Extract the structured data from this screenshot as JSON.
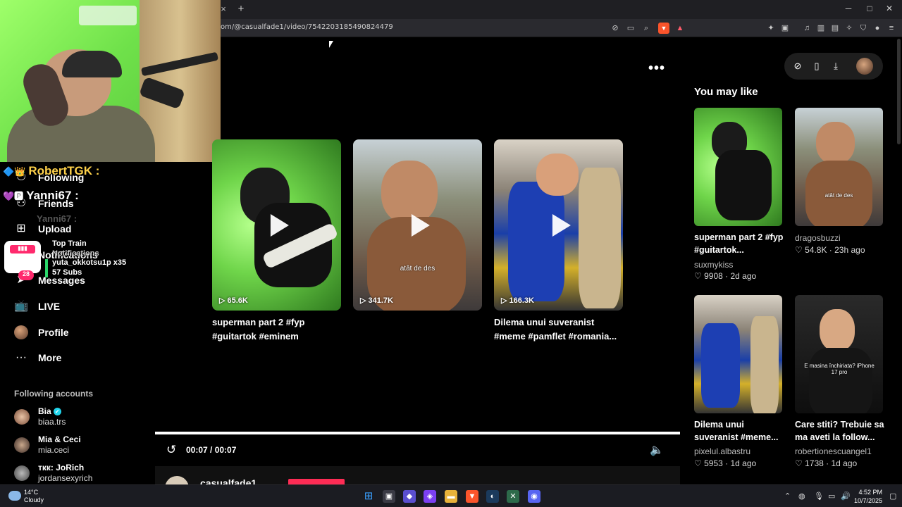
{
  "browser": {
    "url": "om/@casualfade1/video/7542203185490824479",
    "tab_close": "×",
    "new_tab": "+",
    "win_min": "─",
    "win_max": "□",
    "win_close": "✕"
  },
  "chat": {
    "line1_user": "RobertTGK :",
    "line2_user": "Yanni67 :",
    "line3_user": "Yanni67 :",
    "goal_title": "Top Train",
    "goal_line2": "Notifications",
    "goal_user": "yuta_okkotsu1p x35",
    "goal_subs": "57 Subs",
    "goal_badge": "28"
  },
  "nav": {
    "items": [
      {
        "label": "Following"
      },
      {
        "label": "Friends"
      },
      {
        "label": "Upload"
      },
      {
        "label": "Notifications"
      },
      {
        "label": "Messages"
      },
      {
        "label": "LIVE"
      },
      {
        "label": "Profile"
      },
      {
        "label": "More"
      }
    ],
    "following_header": "Following accounts",
    "accounts": [
      {
        "name": "Bia",
        "handle": "biaa.trs"
      },
      {
        "name": "Mia & Ceci",
        "handle": "mia.ceci"
      },
      {
        "name": "ткк: JoRich",
        "handle": "jordansexyrich"
      }
    ]
  },
  "player": {
    "more": "•••",
    "thumbs": [
      {
        "views": "65.6K",
        "caption": "superman part 2 #fyp #guitartok #eminem"
      },
      {
        "views": "341.7K",
        "caption": "",
        "overlay": "atât de des"
      },
      {
        "views": "166.3K",
        "caption": "Dilema unui suveranist #meme #pamflet #romania..."
      }
    ],
    "time": "00:07 / 00:07",
    "progress": 1.0,
    "author": "casualfade1"
  },
  "sidebar": {
    "title": "You may like",
    "cards": [
      {
        "caption": "superman part 2 #fyp #guitartok...",
        "author": "suxmykiss",
        "likes": "9908",
        "age": "2d ago"
      },
      {
        "caption": "",
        "author": "dragosbuzzi",
        "likes": "54.8K",
        "age": "23h ago",
        "overlay": "atât de des"
      },
      {
        "caption": "Dilema unui suveranist #meme...",
        "author": "pixelul.albastru",
        "likes": "5953",
        "age": "1d ago"
      },
      {
        "caption": "Care stiti? Trebuie sa ma aveti la follow...",
        "author": "robertionescuangel1",
        "likes": "1738",
        "age": "1d ago",
        "overlay": "E masina închiriata? iPhone 17 pro"
      }
    ]
  },
  "taskbar": {
    "temp": "14°C",
    "weather": "Cloudy",
    "time": "4:52 PM",
    "date": "10/7/2025"
  },
  "colors": {
    "accent": "#fe2c55",
    "verified": "#20d5ec"
  }
}
